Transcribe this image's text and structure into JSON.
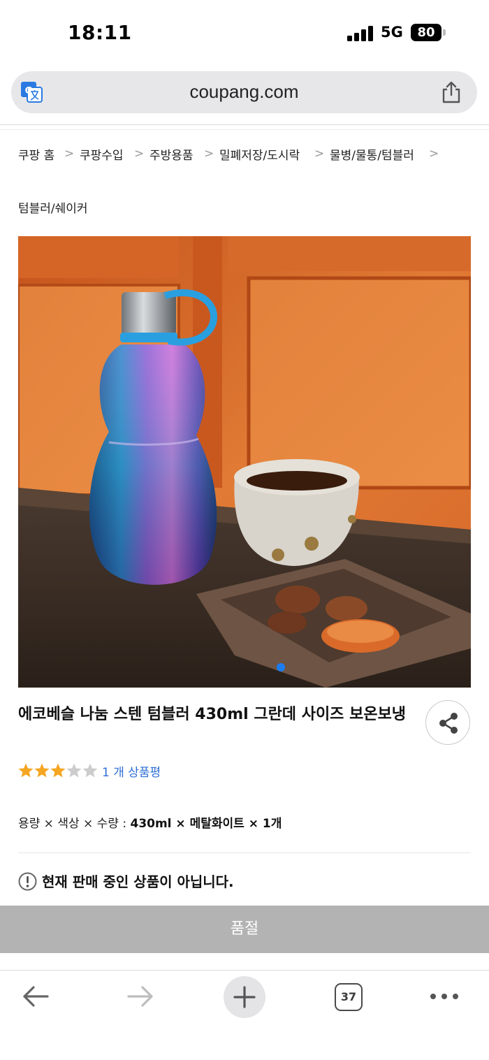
{
  "status_bar": {
    "time": "18:11",
    "network": "5G",
    "battery": "80"
  },
  "browser": {
    "url": "coupang.com",
    "tab_count": "37",
    "icons": {
      "translate": "translate-icon",
      "share": "share-icon",
      "back": "arrow-left-icon",
      "forward": "arrow-right-icon",
      "new_tab": "plus-icon",
      "more": "more-dots-icon"
    }
  },
  "breadcrumb": {
    "items": [
      "쿠팡 홈",
      "쿠팡수입",
      "주방용품",
      "밀폐저장/도시락",
      "물병/물통/텀블러",
      "텀블러/쉐이커"
    ],
    "separator": ">"
  },
  "product": {
    "title": "에코베슬 나눔 스텐 텀블러 430ml 그란데 사이즈 보온보냉",
    "rating": 3,
    "rating_max": 5,
    "review_text": "1 개 상품평",
    "option_label": "용량 × 색상 × 수량 : ",
    "option_value": "430ml × 메탈화이트 × 1개",
    "notice": "현재 판매 중인 상품이 아닙니다.",
    "soldout_label": "품절",
    "image_carousel_dots": 1,
    "active_dot": 0
  },
  "colors": {
    "link_blue": "#2e6fd6",
    "dot_blue": "#1b7df0",
    "star_filled": "#f5a623",
    "star_empty": "#cccccc",
    "soldout_gray": "#b3b3b3"
  }
}
